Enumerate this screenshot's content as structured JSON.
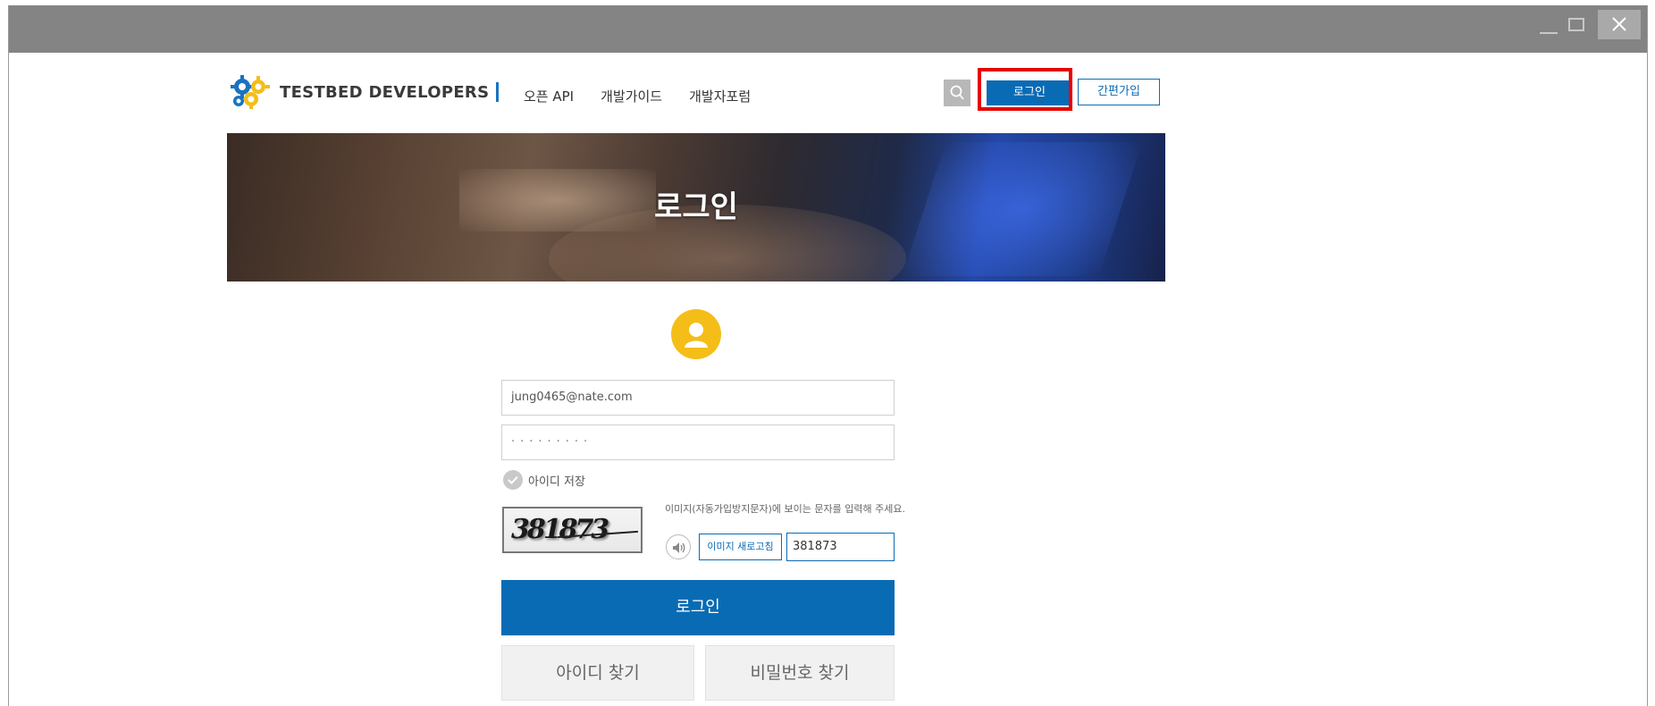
{
  "window": {
    "controls": [
      "minimize-icon",
      "maximize-icon",
      "close-icon"
    ]
  },
  "header": {
    "logo_text": "TESTBED DEVELOPERS",
    "nav": [
      {
        "label": "오픈 API"
      },
      {
        "label": "개발가이드"
      },
      {
        "label": "개발자포럼"
      }
    ],
    "search_icon": "search-icon",
    "login_label": "로그인",
    "signup_label": "간편가입"
  },
  "banner": {
    "title": "로그인"
  },
  "form": {
    "avatar_icon": "user-icon",
    "email_value": "jung0465@nate.com",
    "password_value": "·········",
    "remember_label": "아이디 저장",
    "captcha_image_text": "381873",
    "captcha_hint": "이미지(자동가입방지문자)에 보이는 문자를 입력해 주세요.",
    "audio_icon": "speaker-icon",
    "refresh_label": "이미지 새로고침",
    "captcha_input_value": "381873",
    "submit_label": "로그인",
    "find_id_label": "아이디 찾기",
    "find_pw_label": "비밀번호 찾기"
  },
  "colors": {
    "primary": "#0a6bb5",
    "highlight": "#e60000",
    "avatar": "#f5bd18",
    "titlebar": "#848484"
  }
}
